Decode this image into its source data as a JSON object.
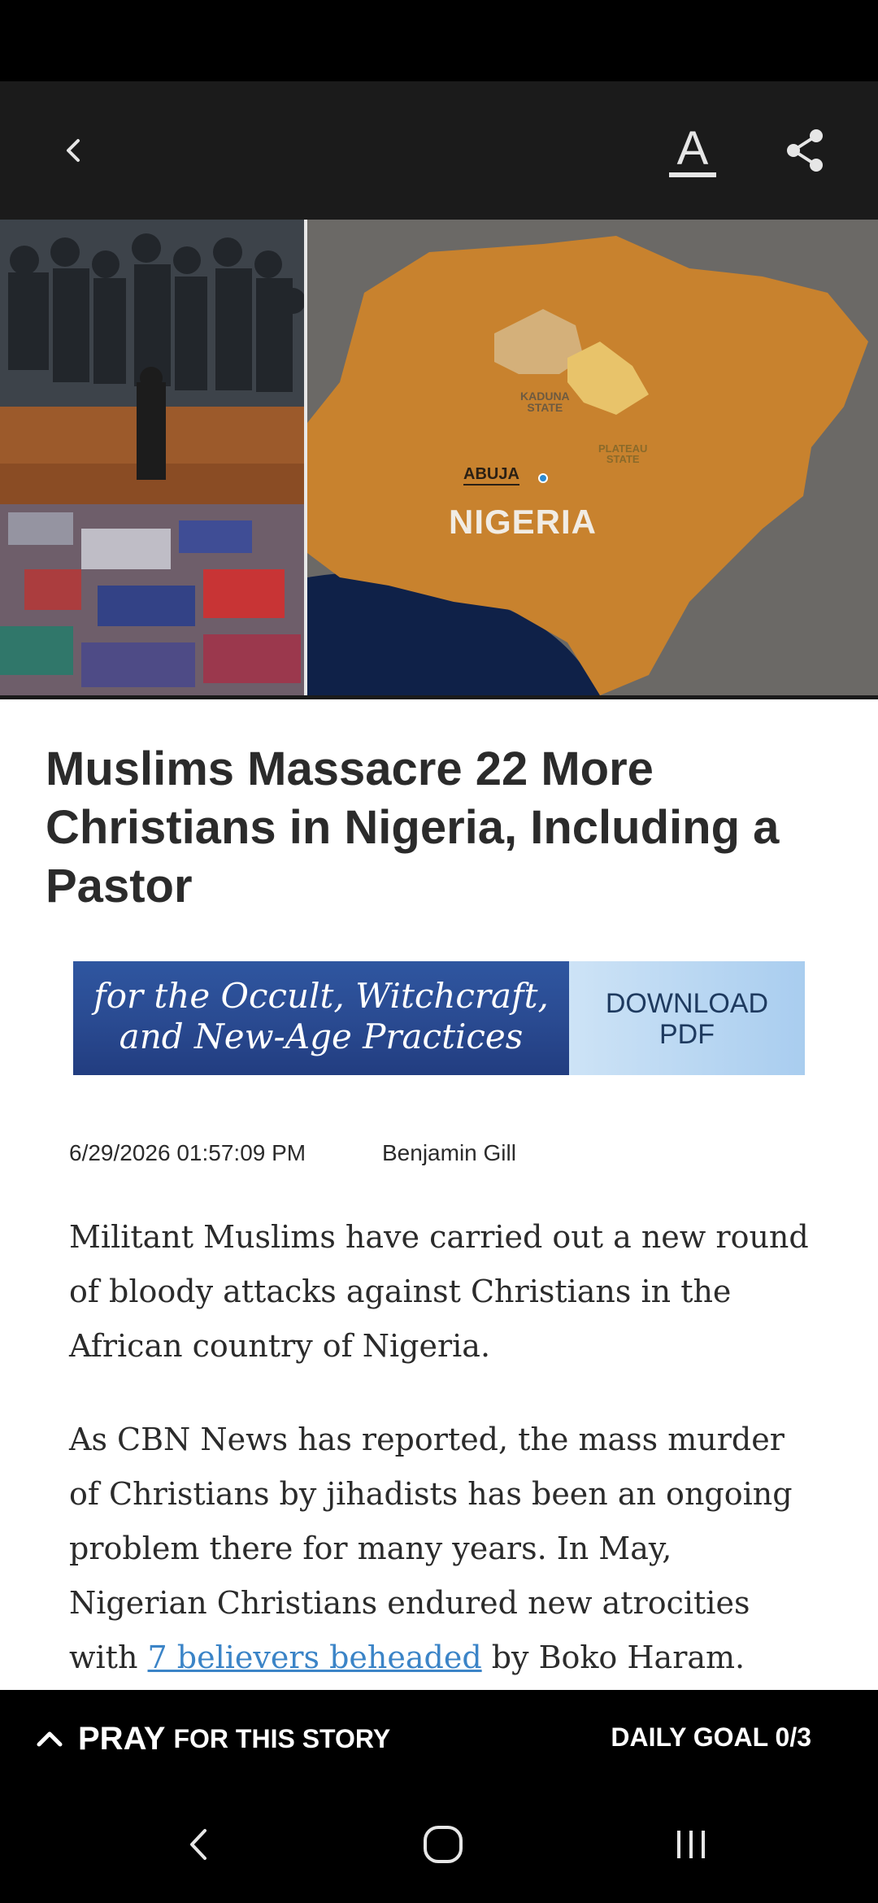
{
  "toolbar": {
    "back_icon": "chevron-left-icon",
    "text_size_label": "A",
    "share_icon": "share-icon"
  },
  "hero": {
    "map_country": "NIGERIA",
    "map_city": "ABUJA",
    "map_state_1": [
      "KADUNA",
      "STATE"
    ],
    "map_state_2": [
      "PLATEAU",
      "STATE"
    ]
  },
  "article": {
    "headline": "Muslims Massacre 22 More Christians in Nigeria, Including a Pastor",
    "date": "6/29/2026 01:57:09 PM",
    "author": "Benjamin Gill",
    "paragraph_1": "Militant Muslims have carried out a new round of bloody attacks against Christians in the African country of Nigeria.",
    "paragraph_2_before_link": "As CBN News has reported, the mass murder of Christians by jihadists has been an ongoing problem there for many years. In May, Nigerian Christians endured new atrocities with ",
    "paragraph_2_link": "7 believers beheaded",
    "paragraph_2_after_link": " by Boko Haram."
  },
  "ad": {
    "text_line_1": "for the Occult, Witchcraft,",
    "text_line_2": "and New-Age Practices",
    "cta_line_1": "DOWNLOAD",
    "cta_line_2": "PDF"
  },
  "pray_bar": {
    "pray_label": "PRAY",
    "pray_suffix": "FOR THIS STORY",
    "daily_goal": "DAILY GOAL 0/3"
  },
  "colors": {
    "app_bar": "#1b1b1b",
    "link": "#3b84c7",
    "text": "#2b2b2b"
  }
}
